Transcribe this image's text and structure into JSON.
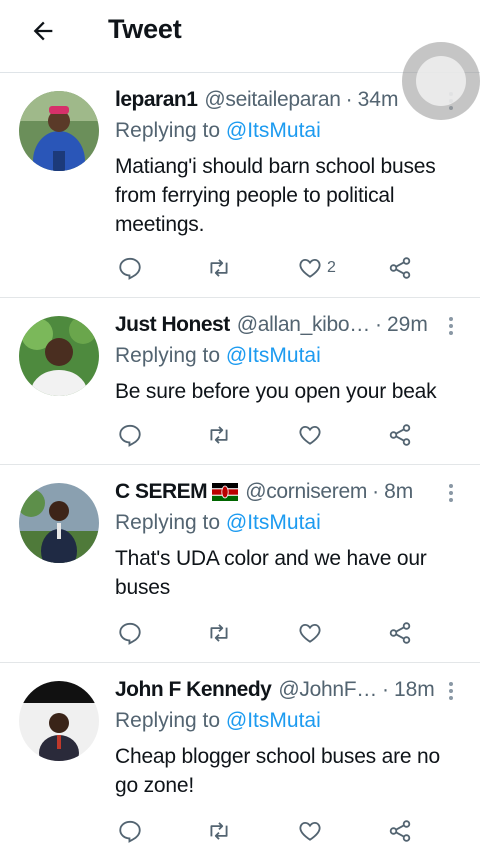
{
  "header": {
    "title": "Tweet"
  },
  "peek_text": "• • • • •",
  "tweets": [
    {
      "name": "leparan1",
      "handle": "@seitaileparan",
      "time": "34m",
      "reply_prefix": "Replying to",
      "mention": "@ItsMutai",
      "text": "Matiang'i should barn school buses from ferrying people to political meetings.",
      "like_count": "2"
    },
    {
      "name": "Just Honest",
      "handle": "@allan_kibo…",
      "time": "29m",
      "reply_prefix": "Replying to",
      "mention": "@ItsMutai",
      "text": "Be sure before you open your beak",
      "like_count": ""
    },
    {
      "name": "C SEREM",
      "flag": "kenya-flag",
      "handle": "@corniserem",
      "time": "8m",
      "reply_prefix": "Replying to",
      "mention": "@ItsMutai",
      "text": "That's UDA color and we have our buses",
      "like_count": ""
    },
    {
      "name": "John F Kennedy",
      "handle": "@JohnF…",
      "time": "18m",
      "reply_prefix": "Replying to",
      "mention": "@ItsMutai",
      "text": "Cheap blogger school buses are no go zone!",
      "like_count": ""
    }
  ],
  "icons": {
    "back": "arrow-left-icon",
    "reply": "reply-icon",
    "retweet": "retweet-icon",
    "like": "heart-icon",
    "share": "share-icon",
    "more": "more-vertical-icon"
  },
  "colors": {
    "accent": "#1d9bf0",
    "secondary": "#536471",
    "text": "#0f1419",
    "divider": "#e3e6e8"
  }
}
